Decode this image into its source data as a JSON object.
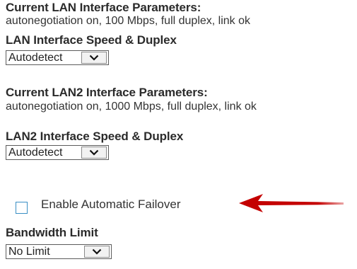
{
  "lan": {
    "current_heading": "Current LAN Interface Parameters:",
    "current_value": "autonegotiation on, 100 Mbps, full duplex, link ok",
    "speed_heading": "LAN Interface Speed & Duplex",
    "speed_selected": "Autodetect"
  },
  "lan2": {
    "current_heading": "Current LAN2 Interface Parameters:",
    "current_value": "autonegotiation on, 1000 Mbps, full duplex, link ok",
    "speed_heading": "LAN2 Interface Speed & Duplex",
    "speed_selected": "Autodetect"
  },
  "failover": {
    "label": "Enable Automatic Failover",
    "checked": false
  },
  "bandwidth": {
    "heading": "Bandwidth Limit",
    "selected": "No Limit"
  },
  "annotation": {
    "arrow_color": "#cc0000",
    "checkbox_border_color": "#3a8fc4"
  }
}
